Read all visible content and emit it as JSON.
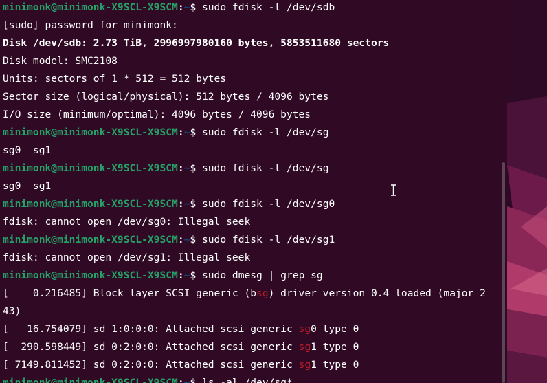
{
  "terminal": {
    "prompt": {
      "user_host": "minimonk@minimonk-X9SCL-X9SCM",
      "separator": ":",
      "path": "~",
      "dollar": "$ "
    },
    "lines": [
      {
        "type": "prompt",
        "command": "sudo fdisk -l /dev/sdb"
      },
      {
        "type": "text",
        "text": "[sudo] password for minimonk:"
      },
      {
        "type": "bold",
        "text": "Disk /dev/sdb: 2.73 TiB, 2996997980160 bytes, 5853511680 sectors"
      },
      {
        "type": "text",
        "text": "Disk model: SMC2108"
      },
      {
        "type": "text",
        "text": "Units: sectors of 1 * 512 = 512 bytes"
      },
      {
        "type": "text",
        "text": "Sector size (logical/physical): 512 bytes / 4096 bytes"
      },
      {
        "type": "text",
        "text": "I/O size (minimum/optimal): 4096 bytes / 4096 bytes"
      },
      {
        "type": "prompt",
        "command": "sudo fdisk -l /dev/sg"
      },
      {
        "type": "text",
        "text": "sg0  sg1"
      },
      {
        "type": "prompt",
        "command": "sudo fdisk -l /dev/sg"
      },
      {
        "type": "text",
        "text": "sg0  sg1"
      },
      {
        "type": "prompt",
        "command": "sudo fdisk -l /dev/sg0"
      },
      {
        "type": "text",
        "text": "fdisk: cannot open /dev/sg0: Illegal seek"
      },
      {
        "type": "prompt",
        "command": "sudo fdisk -l /dev/sg1"
      },
      {
        "type": "text",
        "text": "fdisk: cannot open /dev/sg1: Illegal seek"
      },
      {
        "type": "prompt",
        "command": "sudo dmesg | grep sg"
      },
      {
        "type": "grep",
        "parts": [
          "[    0.216485] Block layer SCSI generic (b",
          "sg",
          ") driver version 0.4 loaded (major 2"
        ]
      },
      {
        "type": "text",
        "text": "43)"
      },
      {
        "type": "grep",
        "parts": [
          "[   16.754079] sd 1:0:0:0: Attached scsi generic ",
          "sg",
          "0 type 0"
        ]
      },
      {
        "type": "grep",
        "parts": [
          "[  290.598449] sd 0:2:0:0: Attached scsi generic ",
          "sg",
          "1 type 0"
        ]
      },
      {
        "type": "grep",
        "parts": [
          "[ 7149.811452] sd 0:2:0:0: Attached scsi generic ",
          "sg",
          "1 type 0"
        ]
      },
      {
        "type": "prompt",
        "command": "ls -al /dev/sg*"
      }
    ]
  },
  "colors": {
    "background": "#300a24",
    "prompt_user": "#26a269",
    "prompt_path": "#12488b",
    "grep_match": "#c01c28",
    "text": "#ffffff"
  },
  "icons": {
    "cursor": "text-cursor-ibeam-icon",
    "wallpaper": "ubuntu-wallpaper-icon"
  }
}
